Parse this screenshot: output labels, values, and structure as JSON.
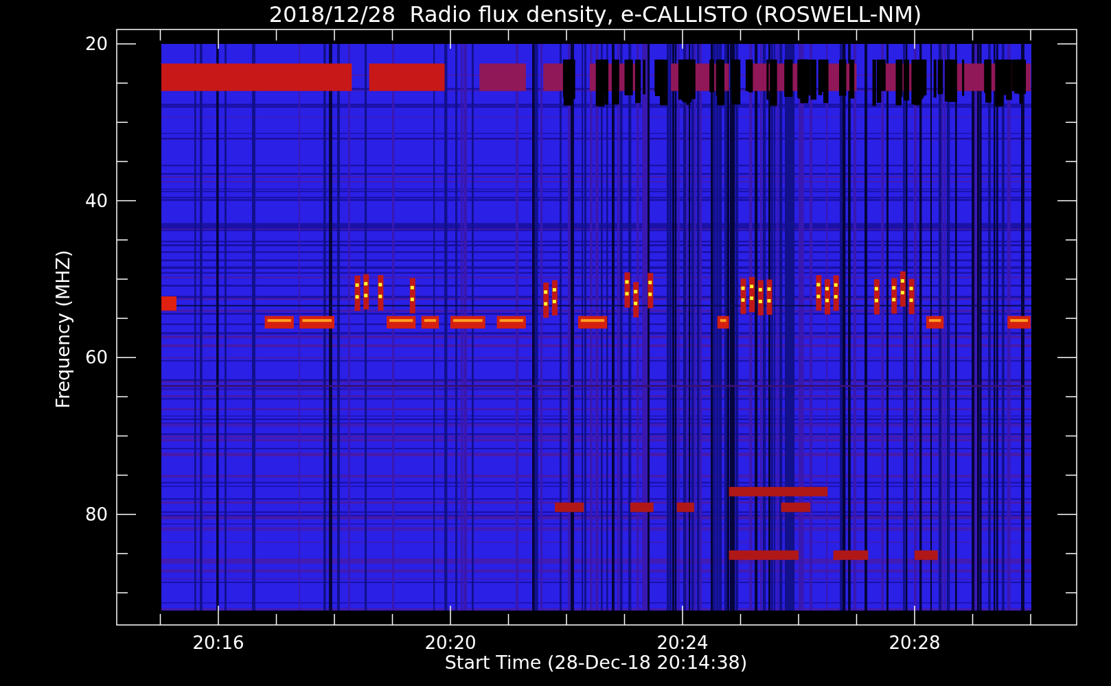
{
  "plot": {
    "title": "2018/12/28  Radio flux density, e-CALLISTO (ROSWELL-NM)",
    "y_axis": {
      "label": "Frequency (MHZ)",
      "ticks": [
        "20",
        "40",
        "60",
        "80"
      ]
    },
    "x_axis": {
      "label": "Start Time (28-Dec-18 20:14:38)",
      "ticks": [
        "20:16",
        "20:20",
        "20:24",
        "20:28"
      ]
    }
  }
}
